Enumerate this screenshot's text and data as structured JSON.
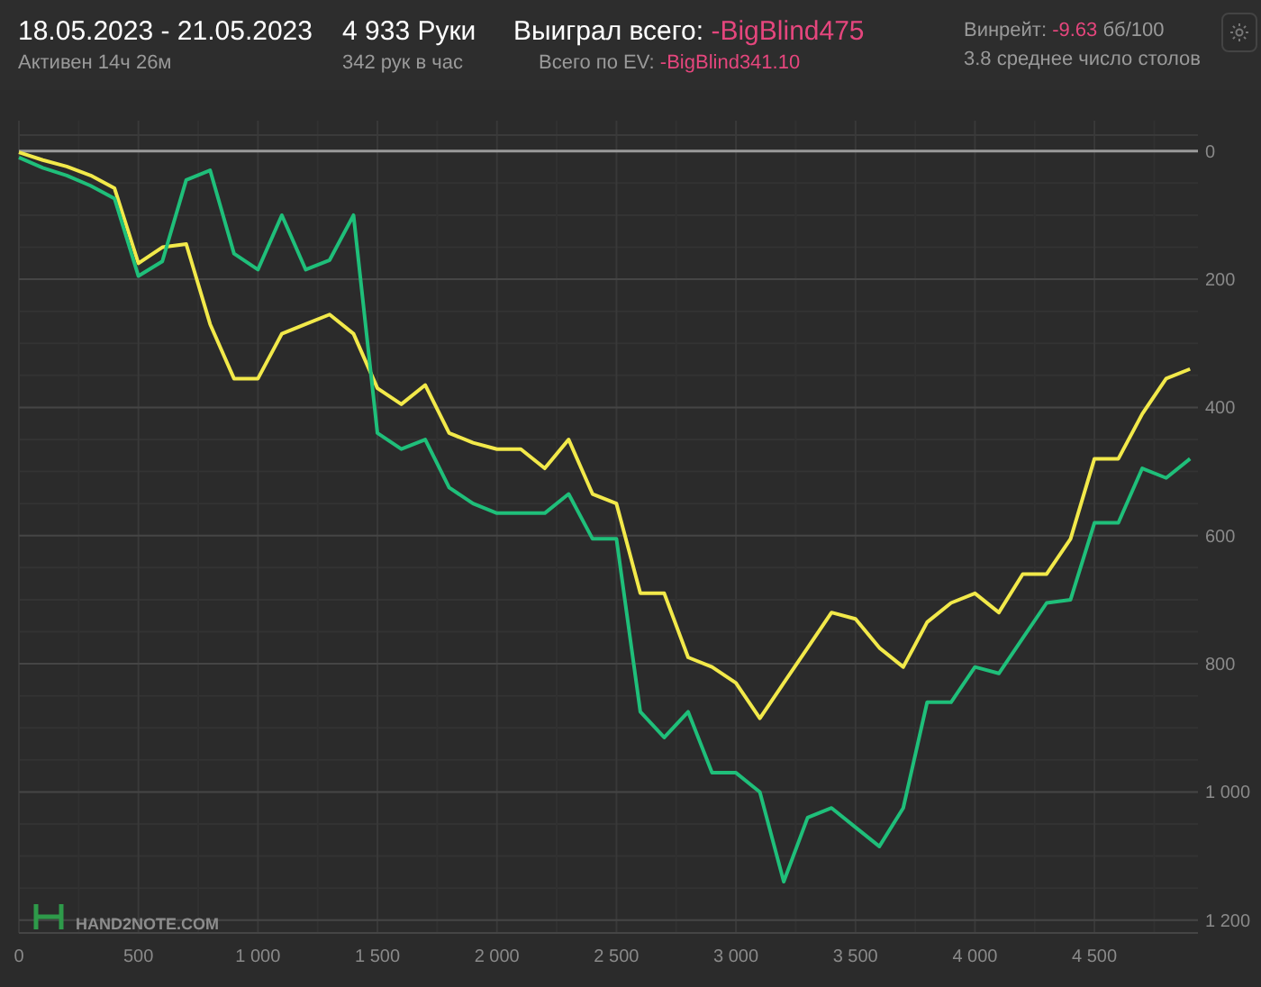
{
  "header": {
    "date_range": "18.05.2023 - 21.05.2023",
    "active_time": "Активен 14ч 26м",
    "hands": "4 933 Руки",
    "hands_per_hour": "342 рук в час",
    "won_total": {
      "label": "Выиграл всего:",
      "value": "-BigBlind475"
    },
    "ev_total": {
      "label": "Всего по EV:",
      "value": "-BigBlind341.10"
    },
    "winrate": {
      "label": "Винрейт:",
      "value": "-9.63",
      "unit": "бб/100"
    },
    "avg_tables": "3.8 среднее число столов"
  },
  "chart": {
    "watermark": "HAND2NOTE.COM",
    "chart_data": {
      "type": "line",
      "x": [
        0,
        100,
        200,
        300,
        400,
        500,
        600,
        700,
        800,
        900,
        1000,
        1100,
        1200,
        1300,
        1400,
        1500,
        1600,
        1700,
        1800,
        1900,
        2000,
        2100,
        2200,
        2300,
        2400,
        2500,
        2600,
        2700,
        2800,
        2900,
        3000,
        3100,
        3200,
        3300,
        3400,
        3500,
        3600,
        3700,
        3800,
        3900,
        4000,
        4100,
        4200,
        4300,
        4400,
        4500,
        4600,
        4700,
        4800,
        4900
      ],
      "series": [
        {
          "color": "#f2e94a",
          "values": [
            -2,
            -14,
            -24,
            -38,
            -58,
            -175,
            -150,
            -145,
            -270,
            -355,
            -355,
            -285,
            -270,
            -255,
            -285,
            -370,
            -395,
            -365,
            -440,
            -455,
            -465,
            -465,
            -495,
            -450,
            -535,
            -550,
            -690,
            -690,
            -790,
            -805,
            -830,
            -885,
            -830,
            -775,
            -720,
            -730,
            -775,
            -805,
            -735,
            -705,
            -690,
            -720,
            -660,
            -660,
            -605,
            -480,
            -480,
            -410,
            -355,
            -340
          ]
        },
        {
          "color": "#1fbf7a",
          "values": [
            -10,
            -26,
            -38,
            -54,
            -74,
            -195,
            -172,
            -45,
            -30,
            -160,
            -185,
            -100,
            -185,
            -170,
            -100,
            -440,
            -465,
            -450,
            -525,
            -550,
            -565,
            -565,
            -565,
            -535,
            -605,
            -605,
            -875,
            -915,
            -875,
            -970,
            -970,
            -1000,
            -1140,
            -1040,
            -1025,
            -1055,
            -1085,
            -1025,
            -860,
            -860,
            -805,
            -815,
            -760,
            -705,
            -700,
            -580,
            -580,
            -495,
            -510,
            -480
          ]
        }
      ],
      "xlim": [
        0,
        4933
      ],
      "ylim": [
        -1220,
        25
      ],
      "grid": true,
      "xticks": [
        0,
        {
          "value": 500,
          "label": "500"
        },
        {
          "value": 1000,
          "label": "1 000"
        },
        {
          "value": 1500,
          "label": "1 500"
        },
        {
          "value": 2000,
          "label": "2 000"
        },
        {
          "value": 2500,
          "label": "2 500"
        },
        {
          "value": 3000,
          "label": "3 000"
        },
        {
          "value": 3500,
          "label": "3 500"
        },
        {
          "value": 4000,
          "label": "4 000"
        },
        {
          "value": 4500,
          "label": "4 500"
        }
      ],
      "yticks": [
        0,
        {
          "value": -200,
          "label": "200"
        },
        {
          "value": -400,
          "label": "400"
        },
        {
          "value": -600,
          "label": "600"
        },
        {
          "value": -800,
          "label": "800"
        },
        {
          "value": -1000,
          "label": "1 000"
        },
        {
          "value": -1200,
          "label": "1 200"
        }
      ]
    }
  }
}
